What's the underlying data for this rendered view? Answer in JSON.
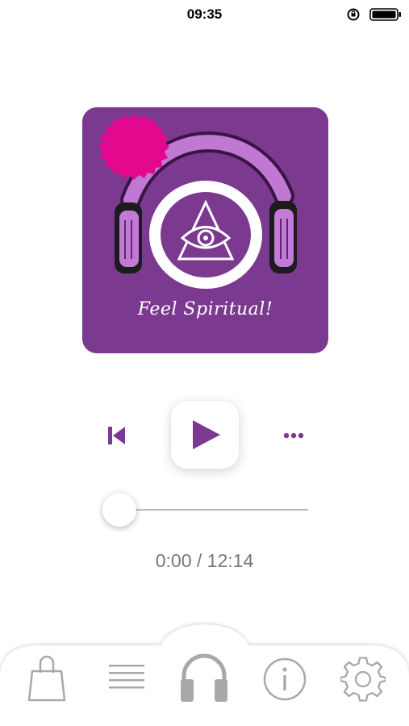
{
  "status_bar": {
    "time": "09:35"
  },
  "album": {
    "title": "Feel Spiritual!"
  },
  "player": {
    "elapsed": "0:00",
    "total": "12:14",
    "time_display": "0:00 / 12:14",
    "progress_fraction": 0.0
  },
  "tabs": [
    {
      "icon": "shopping-bag-icon"
    },
    {
      "icon": "list-icon"
    },
    {
      "icon": "headphones-icon",
      "active": true
    },
    {
      "icon": "info-icon"
    },
    {
      "icon": "gear-icon"
    }
  ],
  "colors": {
    "accent": "#7b3a8f",
    "art_background": "#7b3a8f",
    "sticker": "#e4088f",
    "tab_icon": "#a8a8a8",
    "time_text": "#777777"
  }
}
